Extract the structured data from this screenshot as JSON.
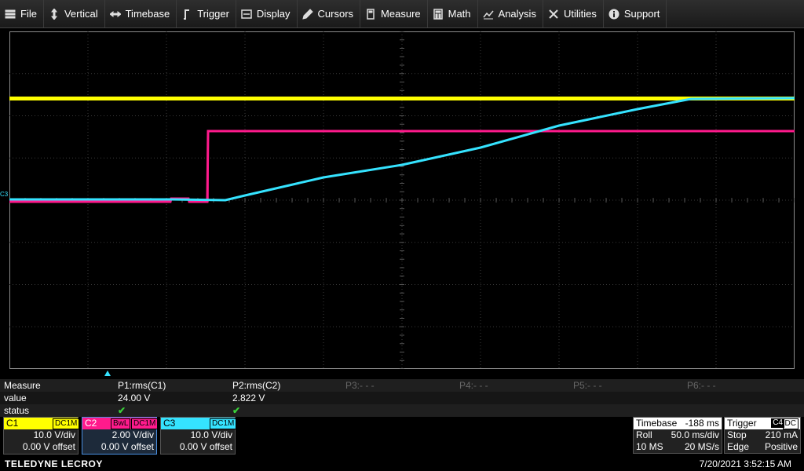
{
  "menu": [
    {
      "label": "File",
      "icon": "menu-icon"
    },
    {
      "label": "Vertical",
      "icon": "vertical-arrows-icon"
    },
    {
      "label": "Timebase",
      "icon": "horizontal-arrows-icon"
    },
    {
      "label": "Trigger",
      "icon": "trigger-icon"
    },
    {
      "label": "Display",
      "icon": "display-icon"
    },
    {
      "label": "Cursors",
      "icon": "cursor-icon"
    },
    {
      "label": "Measure",
      "icon": "measure-icon"
    },
    {
      "label": "Math",
      "icon": "calculator-icon"
    },
    {
      "label": "Analysis",
      "icon": "analysis-icon"
    },
    {
      "label": "Utilities",
      "icon": "tools-icon"
    },
    {
      "label": "Support",
      "icon": "info-icon"
    }
  ],
  "colors": {
    "c1": "#ffff00",
    "c2": "#ff1a8c",
    "c3": "#35e3ff"
  },
  "grid_marker": "C3",
  "measure": {
    "row_labels": [
      "Measure",
      "value",
      "status"
    ],
    "params": [
      {
        "name": "P1:rms(C1)",
        "value": "24.00 V",
        "status": "✔"
      },
      {
        "name": "P2:rms(C2)",
        "value": "2.822 V",
        "status": "✔"
      },
      {
        "name": "P3:- - -",
        "value": "",
        "status": ""
      },
      {
        "name": "P4:- - -",
        "value": "",
        "status": ""
      },
      {
        "name": "P5:- - -",
        "value": "",
        "status": ""
      },
      {
        "name": "P6:- - -",
        "value": "",
        "status": ""
      }
    ]
  },
  "channels": [
    {
      "name": "C1",
      "tags": [
        "DC1M"
      ],
      "vdiv": "10.0 V/div",
      "offset": "0.00 V offset"
    },
    {
      "name": "C2",
      "tags": [
        "BwL",
        "DC1M"
      ],
      "vdiv": "2.00 V/div",
      "offset": "0.00 V offset"
    },
    {
      "name": "C3",
      "tags": [
        "DC1M"
      ],
      "vdiv": "10.0 V/div",
      "offset": "0.00 V offset"
    }
  ],
  "timebase": {
    "title": "Timebase",
    "delay": "-188 ms",
    "mode": "Roll",
    "tdiv": "50.0 ms/div",
    "points": "10 MS",
    "rate": "20 MS/s"
  },
  "trigger": {
    "title": "Trigger",
    "source": "C4",
    "coupling": "DC",
    "state": "Stop",
    "level": "210 mA",
    "type": "Edge",
    "slope": "Positive"
  },
  "footer": {
    "brand": "TELEDYNE LECROY",
    "datetime": "7/20/2021 3:52:15 AM"
  }
}
